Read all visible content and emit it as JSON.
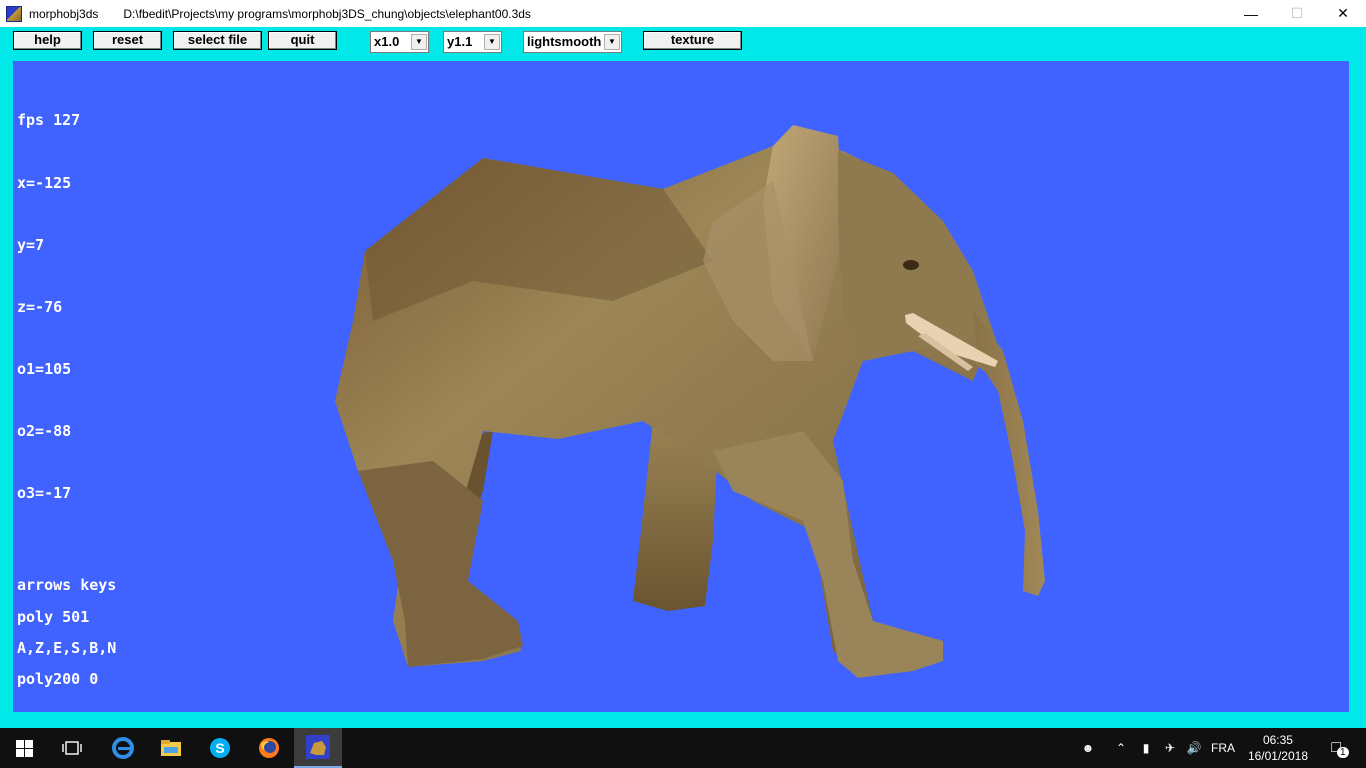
{
  "window": {
    "app_name": "morphobj3ds",
    "document_path": "D:\\fbedit\\Projects\\my programs\\morphobj3DS_chung\\objects\\elephant00.3ds",
    "minimize": "—",
    "maximize": "☐",
    "close": "✕"
  },
  "toolbar": {
    "help_label": "help",
    "reset_label": "reset",
    "select_file_label": "select file",
    "quit_label": "quit",
    "x_scale_value": "x1.0",
    "y_scale_value": "y1.1",
    "lighting_value": "lightsmooth",
    "texture_label": "texture"
  },
  "hud": {
    "fps": "fps 127",
    "x": "x=-125",
    "y": "y=7",
    "z": "z=-76",
    "o1": "o1=105",
    "o2": "o2=-88",
    "o3": "o3=-17",
    "poly": "poly 501",
    "poly200": "poly200 0",
    "keys_title": "arrows keys",
    "keys_list": "A,Z,E,S,B,N"
  },
  "taskbar": {
    "items": [
      "windows-start-icon",
      "task-view-icon",
      "edge-icon",
      "file-explorer-icon",
      "skype-icon",
      "firefox-icon",
      "morphobj3ds-app-icon"
    ],
    "language": "FRA",
    "time": "06:35",
    "date": "16/01/2018",
    "notification_count": "1"
  },
  "colors": {
    "window_bg": "#00e8e8",
    "viewport_bg": "#4062ff",
    "hud_text": "#ffffff",
    "taskbar_bg": "#101010"
  }
}
